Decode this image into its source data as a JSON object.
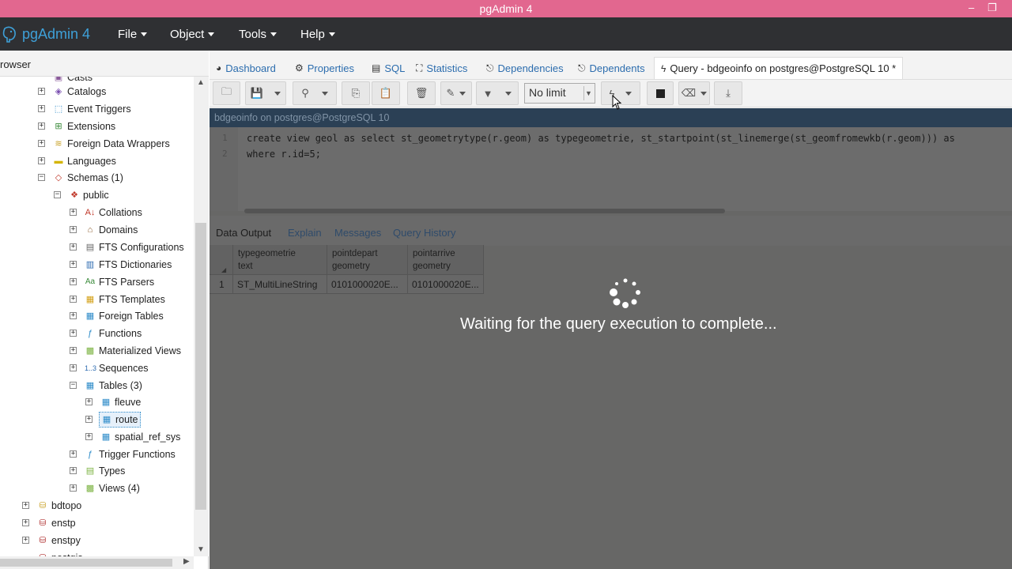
{
  "window": {
    "title": "pgAdmin 4",
    "minimize": "–",
    "restore": "❐"
  },
  "app": {
    "brand": "pgAdmin 4",
    "icon": "elephant-icon"
  },
  "menu": [
    {
      "label": "File"
    },
    {
      "label": "Object"
    },
    {
      "label": "Tools"
    },
    {
      "label": "Help"
    }
  ],
  "browser": {
    "title": "rowser",
    "tree": [
      {
        "label": "Casts",
        "icon": "cast-icon"
      },
      {
        "label": "Catalogs",
        "icon": "catalog-icon"
      },
      {
        "label": "Event Triggers",
        "icon": "event-trigger-icon"
      },
      {
        "label": "Extensions",
        "icon": "extension-icon"
      },
      {
        "label": "Foreign Data Wrappers",
        "icon": "fdw-icon"
      },
      {
        "label": "Languages",
        "icon": "language-icon"
      },
      {
        "label": "Schemas (1)",
        "icon": "schema-icon"
      },
      {
        "label": "public",
        "icon": "schema-icon"
      },
      {
        "label": "Collations",
        "icon": "collation-icon"
      },
      {
        "label": "Domains",
        "icon": "domain-icon"
      },
      {
        "label": "FTS Configurations",
        "icon": "fts-config-icon"
      },
      {
        "label": "FTS Dictionaries",
        "icon": "fts-dictionary-icon"
      },
      {
        "label": "FTS Parsers",
        "icon": "fts-parser-icon"
      },
      {
        "label": "FTS Templates",
        "icon": "fts-template-icon"
      },
      {
        "label": "Foreign Tables",
        "icon": "foreign-table-icon"
      },
      {
        "label": "Functions",
        "icon": "function-icon"
      },
      {
        "label": "Materialized Views",
        "icon": "mview-icon"
      },
      {
        "label": "Sequences",
        "icon": "sequence-icon"
      },
      {
        "label": "Tables (3)",
        "icon": "tables-icon"
      },
      {
        "label": "fleuve",
        "icon": "table-icon"
      },
      {
        "label": "route",
        "icon": "table-icon"
      },
      {
        "label": "spatial_ref_sys",
        "icon": "table-icon"
      },
      {
        "label": "Trigger Functions",
        "icon": "trigger-function-icon"
      },
      {
        "label": "Types",
        "icon": "type-icon"
      },
      {
        "label": "Views (4)",
        "icon": "views-icon"
      },
      {
        "label": "bdtopo",
        "icon": "database-icon"
      },
      {
        "label": "enstp",
        "icon": "database-disconnected-icon"
      },
      {
        "label": "enstpy",
        "icon": "database-disconnected-icon"
      },
      {
        "label": "postgis",
        "icon": "database-disconnected-icon"
      }
    ]
  },
  "tabs": [
    {
      "label": "Dashboard",
      "icon": "dashboard-icon"
    },
    {
      "label": "Properties",
      "icon": "properties-icon"
    },
    {
      "label": "SQL",
      "icon": "sql-icon"
    },
    {
      "label": "Statistics",
      "icon": "statistics-icon"
    },
    {
      "label": "Dependencies",
      "icon": "dependencies-icon"
    },
    {
      "label": "Dependents",
      "icon": "dependents-icon"
    },
    {
      "label": "Query - bdgeoinfo on postgres@PostgreSQL 10 *",
      "icon": "lightning-icon"
    }
  ],
  "toolbar": {
    "limit_value": "No limit"
  },
  "connection": "bdgeoinfo on postgres@PostgreSQL 10",
  "editor": {
    "line_numbers": [
      "1",
      "2"
    ],
    "line1": "create view geol as select st_geometrytype(r.geom) as typegeometrie, st_startpoint(st_linemerge(st_geomfromewkb(r.geom))) as",
    "line2": "where  r.id=5;"
  },
  "output_tabs": [
    {
      "label": "Data Output"
    },
    {
      "label": "Explain"
    },
    {
      "label": "Messages"
    },
    {
      "label": "Query History"
    }
  ],
  "grid": {
    "columns": [
      {
        "name": "typegeometrie",
        "type": "text"
      },
      {
        "name": "pointdepart",
        "type": "geometry"
      },
      {
        "name": "pointarrive",
        "type": "geometry"
      }
    ],
    "rows": [
      {
        "num": "1",
        "cells": [
          "ST_MultiLineString",
          "0101000020E...",
          "0101000020E..."
        ]
      }
    ]
  },
  "status": {
    "waiting": "Waiting for the query execution to complete..."
  },
  "colors": {
    "titlebar": "#e2678f",
    "menubar": "#2f3033",
    "brand": "#3ea0d8",
    "overlay": "#676766"
  }
}
